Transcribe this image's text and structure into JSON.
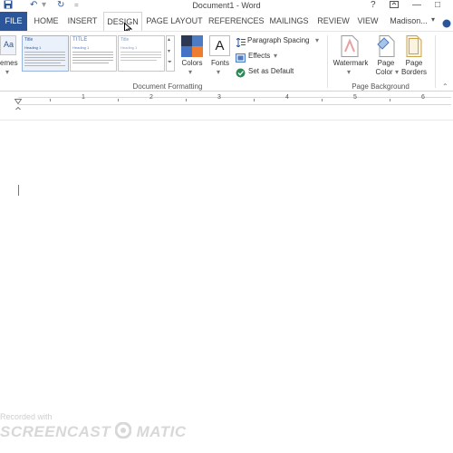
{
  "window": {
    "title": "Document1 - Word",
    "help": "?",
    "account": "Madison..."
  },
  "tabs": [
    {
      "label": "FILE"
    },
    {
      "label": "HOME"
    },
    {
      "label": "INSERT"
    },
    {
      "label": "DESIGN"
    },
    {
      "label": "PAGE LAYOUT"
    },
    {
      "label": "REFERENCES"
    },
    {
      "label": "MAILINGS"
    },
    {
      "label": "REVIEW"
    },
    {
      "label": "VIEW"
    }
  ],
  "ribbon": {
    "themes_label": "emes",
    "style_thumbs": [
      {
        "title": "Title",
        "heading": "Heading 1"
      },
      {
        "title": "TITLE",
        "heading": "Heading 1"
      },
      {
        "title": "Title",
        "heading": "Heading 1"
      }
    ],
    "colors_label": "Colors",
    "fonts_label": "Fonts",
    "fonts_glyph": "A",
    "paragraph_spacing": "Paragraph Spacing",
    "effects": "Effects",
    "set_as_default": "Set as Default",
    "group_document_formatting": "Document Formatting",
    "watermark_label": "Watermark",
    "page_color_line1": "Page",
    "page_color_line2": "Color",
    "page_borders_line1": "Page",
    "page_borders_line2": "Borders",
    "group_page_background": "Page Background"
  },
  "ruler": {
    "numbers": [
      "1",
      "2",
      "3",
      "4",
      "5",
      "6"
    ]
  },
  "watermark": {
    "recorded": "Recorded with",
    "brand_left": "SCREENCAST",
    "brand_right": "MATIC"
  },
  "colors": {
    "accent": "#2b579a"
  }
}
